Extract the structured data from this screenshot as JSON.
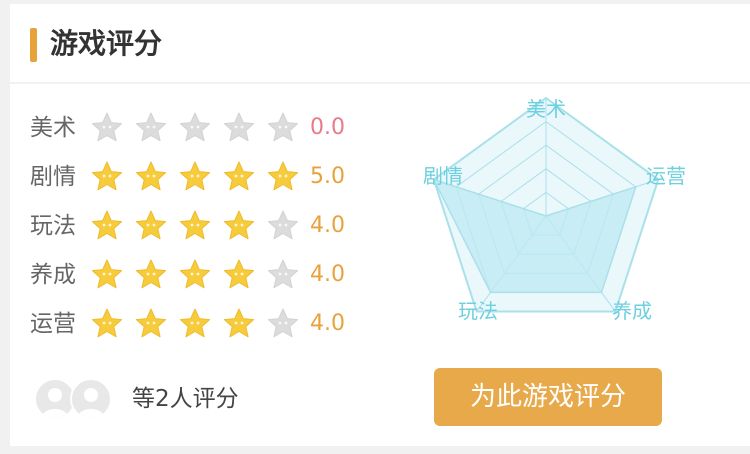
{
  "section": {
    "title": "游戏评分"
  },
  "colors": {
    "accent": "#e8a23c",
    "star_filled": "#f7cc3c",
    "star_empty": "#dcdcdc",
    "score_zero": "#e87a8a",
    "radar_stroke": "#a9e0ea",
    "radar_fill": "#bde9f1",
    "radar_label": "#6cd0e0"
  },
  "ratings": [
    {
      "label": "美术",
      "score": "0.0",
      "value": 0
    },
    {
      "label": "剧情",
      "score": "5.0",
      "value": 5
    },
    {
      "label": "玩法",
      "score": "4.0",
      "value": 4
    },
    {
      "label": "养成",
      "score": "4.0",
      "value": 4
    },
    {
      "label": "运营",
      "score": "4.0",
      "value": 4
    }
  ],
  "max_stars": 5,
  "radar": {
    "labels": {
      "top": "美术",
      "right": "运营",
      "bottom_right": "养成",
      "bottom_left": "玩法",
      "left": "剧情"
    }
  },
  "raters": {
    "text": "等2人评分",
    "avatar_icon": "user-avatar-icon"
  },
  "action": {
    "rate_label": "为此游戏评分"
  }
}
